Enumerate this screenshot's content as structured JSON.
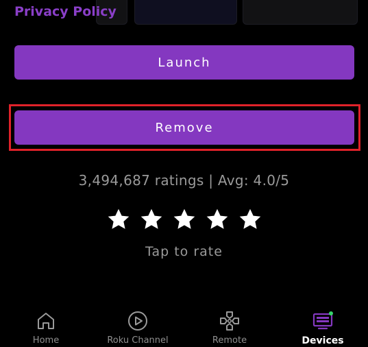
{
  "header": {
    "privacy_link": "Privacy Policy"
  },
  "actions": {
    "launch_label": "Launch",
    "remove_label": "Remove"
  },
  "rating": {
    "summary": "3,494,687 ratings | Avg: 4.0/5",
    "stars": 5,
    "tap_label": "Tap to rate"
  },
  "nav": {
    "items": [
      {
        "label": "Home",
        "icon": "home-icon"
      },
      {
        "label": "Roku Channel",
        "icon": "play-icon"
      },
      {
        "label": "Remote",
        "icon": "remote-dpad-icon"
      },
      {
        "label": "Devices",
        "icon": "tv-icon",
        "active": true
      }
    ]
  },
  "colors": {
    "accent_purple": "#8438c0",
    "link_purple": "#8a3fc8",
    "highlight_red": "#e0222a",
    "status_dot_green": "#36d36b"
  }
}
